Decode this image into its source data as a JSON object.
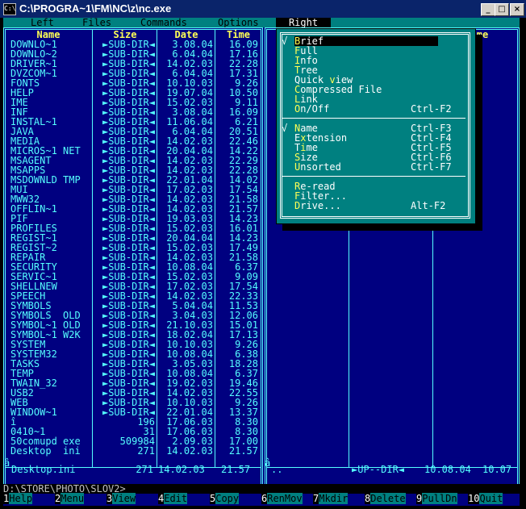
{
  "window": {
    "title": "C:\\PROGRA~1\\FM\\NC\\z\\nc.exe",
    "controls": [
      "_",
      "□",
      "×"
    ]
  },
  "menubar": [
    "Left",
    "Files",
    "Commands",
    "Options",
    "Right"
  ],
  "left_panel": {
    "headers": [
      "Name",
      "Size",
      "Date",
      "Time"
    ],
    "rows": [
      [
        "DOWNLO~1",
        "►SUB-DIR◄",
        "3.08.04",
        "16.09"
      ],
      [
        "DOWNLO~2",
        "►SUB-DIR◄",
        "6.04.04",
        "17.16"
      ],
      [
        "DRIVER~1",
        "►SUB-DIR◄",
        "14.02.03",
        "22.28"
      ],
      [
        "DVZCOM~1",
        "►SUB-DIR◄",
        "6.04.04",
        "17.31"
      ],
      [
        "FONTS",
        "►SUB-DIR◄",
        "10.10.03",
        "9.26"
      ],
      [
        "HELP",
        "►SUB-DIR◄",
        "19.07.04",
        "10.50"
      ],
      [
        "IME",
        "►SUB-DIR◄",
        "15.02.03",
        "9.11"
      ],
      [
        "INF",
        "►SUB-DIR◄",
        "3.08.04",
        "16.09"
      ],
      [
        "INSTAL~1",
        "►SUB-DIR◄",
        "11.06.04",
        "6.21"
      ],
      [
        "JAVA",
        "►SUB-DIR◄",
        "6.04.04",
        "20.51"
      ],
      [
        "MEDIA",
        "►SUB-DIR◄",
        "14.02.03",
        "22.46"
      ],
      [
        "MICROS~1 NET",
        "►SUB-DIR◄",
        "20.04.04",
        "14.22"
      ],
      [
        "MSAGENT",
        "►SUB-DIR◄",
        "14.02.03",
        "22.29"
      ],
      [
        "MSAPPS",
        "►SUB-DIR◄",
        "14.02.03",
        "22.28"
      ],
      [
        "MSDOWNLD TMP",
        "►SUB-DIR◄",
        "22.01.04",
        "14.02"
      ],
      [
        "MUI",
        "►SUB-DIR◄",
        "17.02.03",
        "17.54"
      ],
      [
        "MWW32",
        "►SUB-DIR◄",
        "14.02.03",
        "21.58"
      ],
      [
        "OFFLIN~1",
        "►SUB-DIR◄",
        "14.02.03",
        "21.57"
      ],
      [
        "PIF",
        "►SUB-DIR◄",
        "19.03.03",
        "14.23"
      ],
      [
        "PROFILES",
        "►SUB-DIR◄",
        "15.02.03",
        "16.01"
      ],
      [
        "REGIST~1",
        "►SUB-DIR◄",
        "20.04.04",
        "14.23"
      ],
      [
        "REGIST~2",
        "►SUB-DIR◄",
        "15.02.03",
        "17.49"
      ],
      [
        "REPAIR",
        "►SUB-DIR◄",
        "14.02.03",
        "21.58"
      ],
      [
        "SECURITY",
        "►SUB-DIR◄",
        "10.08.04",
        "6.37"
      ],
      [
        "SERVIC~1",
        "►SUB-DIR◄",
        "15.02.03",
        "9.09"
      ],
      [
        "SHELLNEW",
        "►SUB-DIR◄",
        "17.02.03",
        "17.54"
      ],
      [
        "SPEECH",
        "►SUB-DIR◄",
        "14.02.03",
        "22.33"
      ],
      [
        "SYMBOLS",
        "►SUB-DIR◄",
        "5.04.04",
        "11.53"
      ],
      [
        "SYMBOLS  OLD",
        "►SUB-DIR◄",
        "3.04.03",
        "12.06"
      ],
      [
        "SYMBOL~1 OLD",
        "►SUB-DIR◄",
        "21.10.03",
        "15.01"
      ],
      [
        "SYMBOL~1 W2K",
        "►SUB-DIR◄",
        "18.02.04",
        "17.13"
      ],
      [
        "SYSTEM",
        "►SUB-DIR◄",
        "10.10.03",
        "9.26"
      ],
      [
        "SYSTEM32",
        "►SUB-DIR◄",
        "10.08.04",
        "6.38"
      ],
      [
        "TASKS",
        "►SUB-DIR◄",
        "3.05.03",
        "18.28"
      ],
      [
        "TEMP",
        "►SUB-DIR◄",
        "10.08.04",
        "6.37"
      ],
      [
        "TWAIN_32",
        "►SUB-DIR◄",
        "19.02.03",
        "19.46"
      ],
      [
        "USB2",
        "►SUB-DIR◄",
        "14.02.03",
        "22.55"
      ],
      [
        "WEB",
        "►SUB-DIR◄",
        "10.10.03",
        "9.26"
      ],
      [
        "WINDOW~1",
        "►SUB-DIR◄",
        "22.01.04",
        "13.37"
      ],
      [
        "î",
        "196",
        "17.06.03",
        "8.30"
      ],
      [
        "0410~1",
        "31",
        "17.06.03",
        "8.30"
      ],
      [
        "50comupd exe",
        "509984",
        "2.09.03",
        "17.00"
      ],
      [
        "Desktop  ini",
        "271",
        "14.02.03",
        "21.57"
      ]
    ],
    "status": {
      "name": "Desktop.ini",
      "size": "271",
      "date": "14.02.03",
      "time": "21.57"
    }
  },
  "right_panel": {
    "header_fragment": "me",
    "status": {
      "name": "..",
      "size": "►UP--DIR◄",
      "date": "10.08.04",
      "time": "10.07"
    }
  },
  "dropdown": {
    "items": [
      {
        "mark": "√",
        "label": "Brief",
        "hotkey": "B",
        "shortcut": "",
        "selected": true
      },
      {
        "mark": "",
        "label": "Full",
        "hotkey": "F",
        "shortcut": ""
      },
      {
        "mark": "",
        "label": "Info",
        "hotkey": "I",
        "shortcut": ""
      },
      {
        "mark": "",
        "label": "Tree",
        "hotkey": "T",
        "shortcut": ""
      },
      {
        "mark": "",
        "label": "Quick view",
        "hotkey": "v",
        "shortcut": ""
      },
      {
        "mark": "",
        "label": "Compressed File",
        "hotkey": "C",
        "shortcut": ""
      },
      {
        "mark": "",
        "label": "Link",
        "hotkey": "L",
        "shortcut": ""
      },
      {
        "mark": "",
        "label": "On/Off",
        "hotkey": "O",
        "shortcut": "Ctrl-F2"
      },
      {
        "separator": true
      },
      {
        "mark": "√",
        "label": "Name",
        "hotkey": "N",
        "shortcut": "Ctrl-F3"
      },
      {
        "mark": "",
        "label": "Extension",
        "hotkey": "x",
        "shortcut": "Ctrl-F4"
      },
      {
        "mark": "",
        "label": "Time",
        "hotkey": "i",
        "shortcut": "Ctrl-F5"
      },
      {
        "mark": "",
        "label": "Size",
        "hotkey": "S",
        "shortcut": "Ctrl-F6"
      },
      {
        "mark": "",
        "label": "Unsorted",
        "hotkey": "U",
        "shortcut": "Ctrl-F7"
      },
      {
        "separator": true
      },
      {
        "mark": "",
        "label": "Re-read",
        "hotkey": "R",
        "shortcut": ""
      },
      {
        "mark": "",
        "label": "Filter...",
        "hotkey": "F",
        "shortcut": ""
      },
      {
        "mark": "",
        "label": "Drive...",
        "hotkey": "D",
        "shortcut": "Alt-F2"
      }
    ]
  },
  "command_line": "D:\\STORE\\PHOTO\\SLOV2>",
  "fkeys": [
    {
      "n": "1",
      "label": "Help"
    },
    {
      "n": "2",
      "label": "Menu"
    },
    {
      "n": "3",
      "label": "View"
    },
    {
      "n": "4",
      "label": "Edit"
    },
    {
      "n": "5",
      "label": "Copy"
    },
    {
      "n": "6",
      "label": "RenMov"
    },
    {
      "n": "7",
      "label": "Mkdir"
    },
    {
      "n": "8",
      "label": "Delete"
    },
    {
      "n": "9",
      "label": "PullDn"
    },
    {
      "n": "10",
      "label": "Quit"
    }
  ],
  "colors": {
    "panel_bg": "#000080",
    "text": "#55ffff",
    "highlight": "#ffff55",
    "menu_bg": "#008080",
    "title_bg": "#0a246a"
  }
}
